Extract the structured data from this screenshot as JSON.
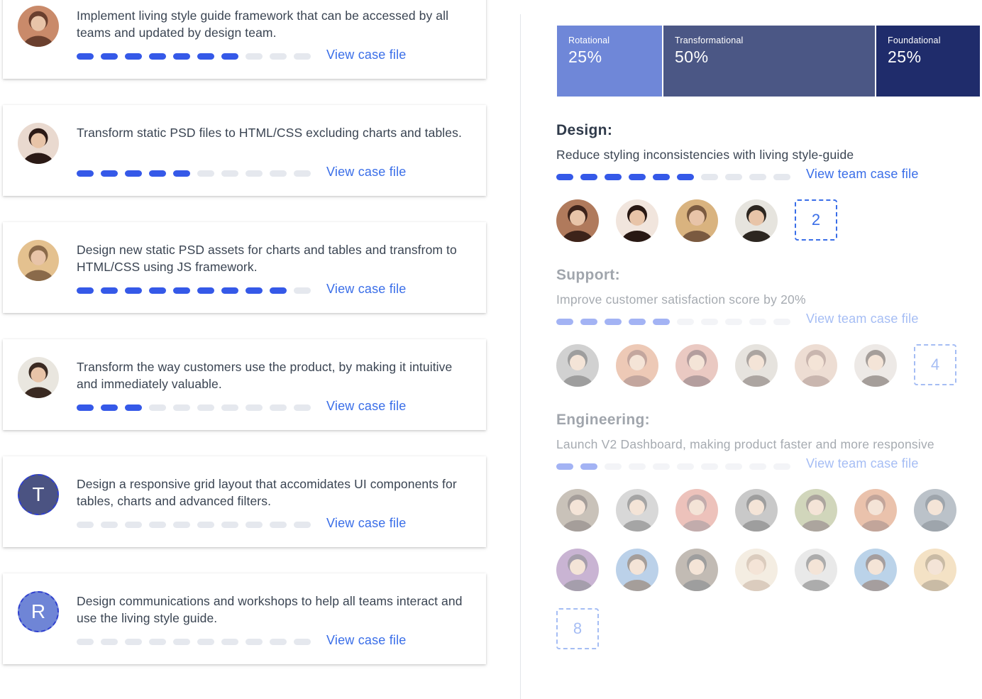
{
  "tasks": [
    {
      "text": "Implement living style guide framework that can be accessed by all teams and updated by design team.",
      "progress": 7,
      "total": 10,
      "link": "View case file",
      "avatar": {
        "type": "photo",
        "icon": "person-photo",
        "colors": [
          "#c98a6a",
          "#6a3f2e"
        ]
      }
    },
    {
      "text": "Transform static PSD files to HTML/CSS excluding charts and tables.",
      "progress": 5,
      "total": 10,
      "link": "View case file",
      "avatar": {
        "type": "photo",
        "icon": "person-photo",
        "colors": [
          "#e9d9cf",
          "#2b1a16"
        ]
      }
    },
    {
      "text": "Design new static PSD assets for charts and tables and transfrom to HTML/CSS using JS framework.",
      "progress": 9,
      "total": 10,
      "link": "View case file",
      "avatar": {
        "type": "photo",
        "icon": "person-photo",
        "colors": [
          "#e4c18f",
          "#8a6a4a"
        ]
      }
    },
    {
      "text": "Transform the way customers use the product, by making it intuitive and immediately valuable.",
      "progress": 3,
      "total": 10,
      "link": "View case file",
      "avatar": {
        "type": "photo",
        "icon": "person-photo",
        "colors": [
          "#e9e6df",
          "#3a2a22"
        ]
      }
    },
    {
      "text": "Design a responsive grid layout that accomidates UI components for tables, charts and advanced filters.",
      "progress": 0,
      "total": 10,
      "link": "View case file",
      "avatar": {
        "type": "letter",
        "letter": "T",
        "color": "#4b5382"
      }
    },
    {
      "text": "Design communications and workshops to help all teams interact and use the living style guide.",
      "progress": 0,
      "total": 10,
      "link": "View case file",
      "avatar": {
        "type": "letter",
        "letter": "R",
        "color": "#6f85d6"
      }
    }
  ],
  "allocation": [
    {
      "label": "Rotational",
      "percent": "25%",
      "color": "#6f87d8"
    },
    {
      "label": "Transformational",
      "percent": "50%",
      "color": "#4b5785"
    },
    {
      "label": "Foundational",
      "percent": "25%",
      "color": "#1f2c6b"
    }
  ],
  "teams": [
    {
      "title": "Design:",
      "goal": "Reduce styling inconsistencies with living style-guide",
      "progress": 6,
      "total": 10,
      "link": "View team case file",
      "faded": false,
      "members": [
        [
          "#b07a5c",
          "#3d231a"
        ],
        [
          "#f1e5dd",
          "#281813"
        ],
        [
          "#d9b37f",
          "#7a5a40"
        ],
        [
          "#e6e4de",
          "#2c2620"
        ]
      ],
      "more": "2"
    },
    {
      "title": "Support:",
      "goal": "Improve customer satisfaction score by 20%",
      "progress": 5,
      "total": 10,
      "link": "View team case file",
      "faded": true,
      "members": [
        [
          "#9a9a9a",
          "#2a2a2a"
        ],
        [
          "#d88a60",
          "#7b3c2a"
        ],
        [
          "#d28a7a",
          "#5a2a2a"
        ],
        [
          "#c9c2b8",
          "#4a3a30"
        ],
        [
          "#d8b6a0",
          "#8a6050"
        ],
        [
          "#d8d0c8",
          "#3a2a22"
        ]
      ],
      "more": "4"
    },
    {
      "title": "Engineering:",
      "goal": "Launch V2 Dashboard, making product faster and more responsive",
      "progress": 2,
      "total": 10,
      "link": "View team case file",
      "faded": true,
      "members": [
        [
          "#8a7a66",
          "#3a2a22"
        ],
        [
          "#a9a9a9",
          "#3a3a3a"
        ],
        [
          "#d87a6a",
          "#7a4a4a"
        ],
        [
          "#8a8a8a",
          "#2a2a2a"
        ],
        [
          "#9aa66a",
          "#4a3a2a"
        ],
        [
          "#d27a4a",
          "#7a3a22"
        ],
        [
          "#6a7a8a",
          "#2a3a4a"
        ],
        [
          "#8a5aa0",
          "#3a2a4a"
        ],
        [
          "#6a9ad0",
          "#3a2a22"
        ],
        [
          "#7a6a5a",
          "#2a2a2a"
        ],
        [
          "#e8d8c0",
          "#b09070"
        ],
        [
          "#cfcfcf",
          "#4a4a4a"
        ],
        [
          "#6aa0d0",
          "#3a2a2a"
        ],
        [
          "#e8c080",
          "#8a6a3a"
        ]
      ],
      "more": "8"
    }
  ]
}
